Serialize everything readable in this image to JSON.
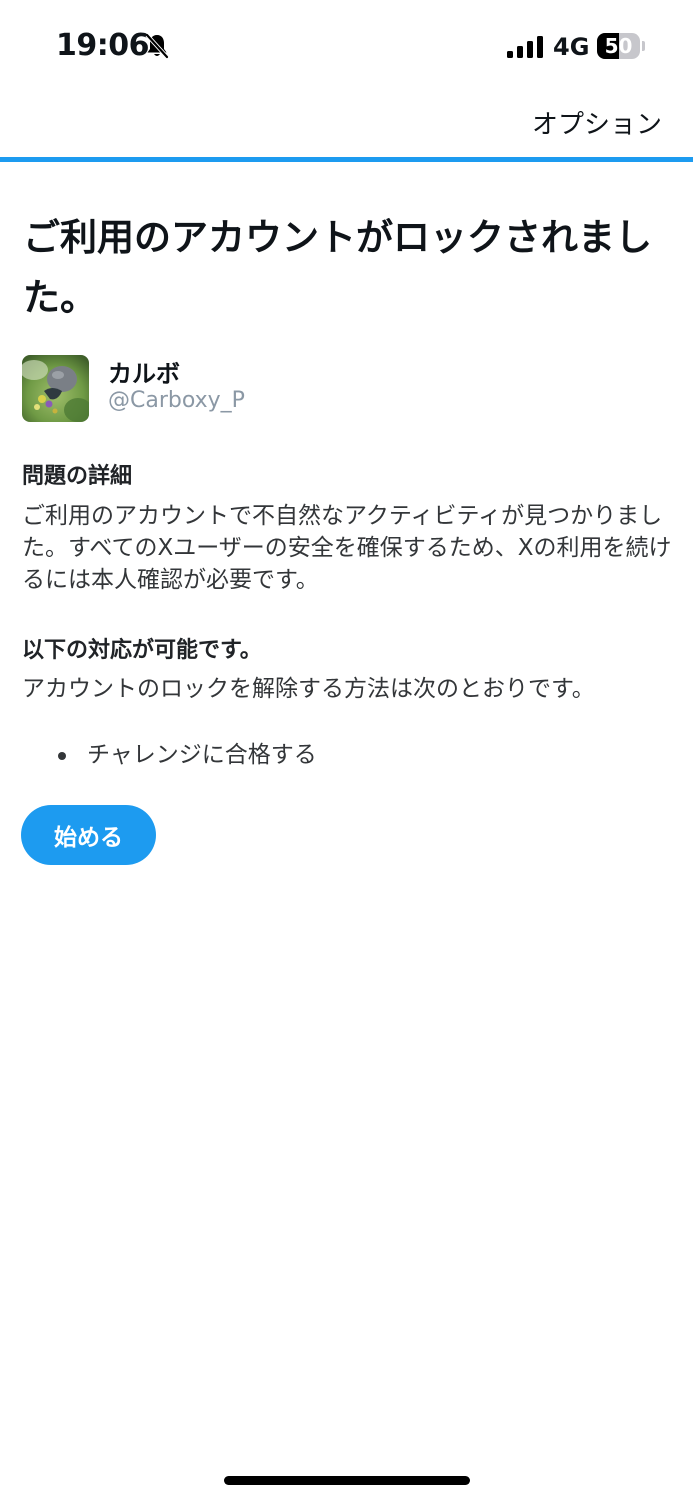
{
  "status_bar": {
    "time": "19:06",
    "network": "4G",
    "battery_level": "50",
    "battery_fraction": 0.5,
    "icons": [
      "bell-slash-icon",
      "signal-icon",
      "battery-icon"
    ]
  },
  "header": {
    "options_label": "オプション",
    "accent_color": "#1d9bf0"
  },
  "main": {
    "title": "ご利用のアカウントがロックされました。",
    "account": {
      "display_name": "カルボ",
      "handle": "@Carboxy_P"
    },
    "details": {
      "heading": "問題の詳細",
      "body": "ご利用のアカウントで不自然なアクティビティが見つかりました。すべてのXユーザーの安全を確保するため、Xの利用を続けるには本人確認が必要です。"
    },
    "actions": {
      "heading": "以下の対応が可能です。",
      "body": "アカウントのロックを解除する方法は次のとおりです。",
      "items": [
        "チャレンジに合格する"
      ]
    },
    "start_button_label": "始める"
  },
  "colors": {
    "accent": "#1d9bf0",
    "text": "#0f1419",
    "secondary_text": "#8b98a5"
  }
}
